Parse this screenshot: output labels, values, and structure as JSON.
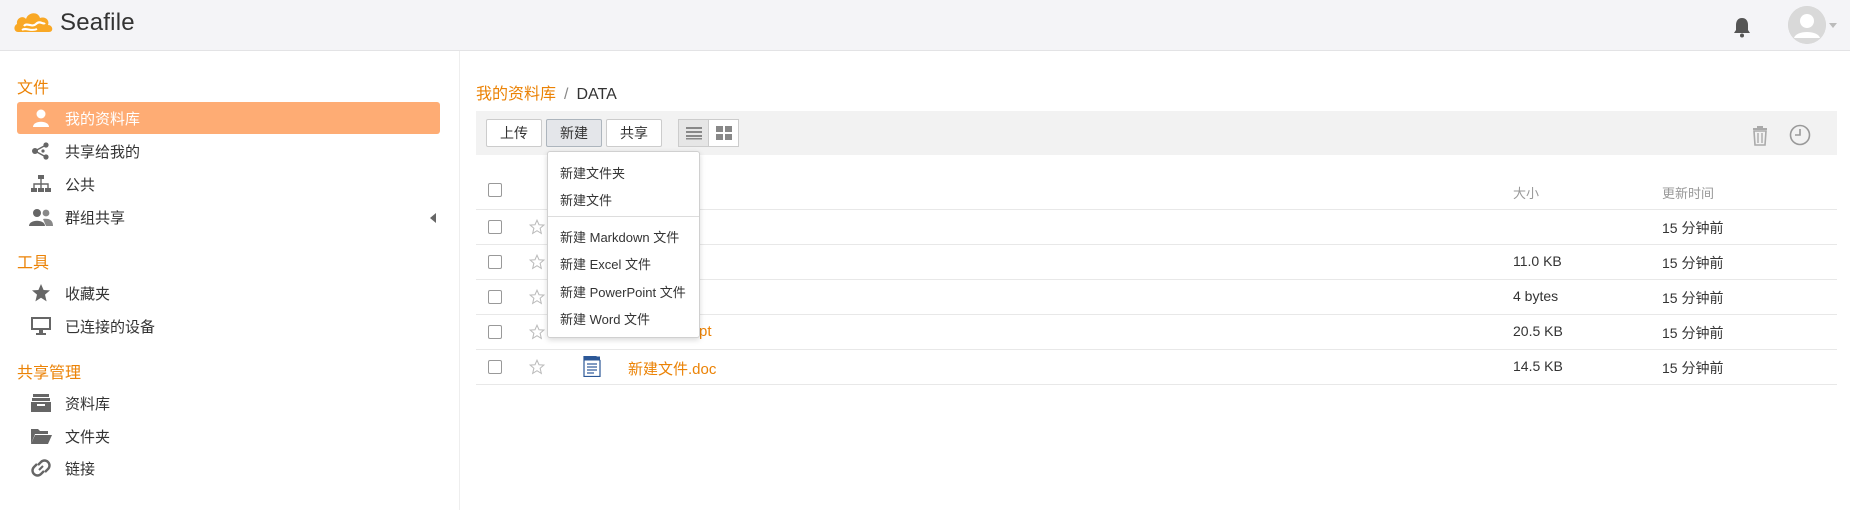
{
  "header": {
    "logo_text": "Seafile",
    "brand_color": "#f9a825"
  },
  "sidebar": {
    "sections": [
      {
        "title": "文件",
        "items": [
          {
            "label": "我的资料库",
            "icon": "user-icon",
            "active": true
          },
          {
            "label": "共享给我的",
            "icon": "share-icon"
          },
          {
            "label": "公共",
            "icon": "org-tree-icon"
          },
          {
            "label": "群组共享",
            "icon": "group-icon",
            "has_caret": true
          }
        ]
      },
      {
        "title": "工具",
        "items": [
          {
            "label": "收藏夹",
            "icon": "star-icon"
          },
          {
            "label": "已连接的设备",
            "icon": "monitor-icon"
          }
        ]
      },
      {
        "title": "共享管理",
        "items": [
          {
            "label": "资料库",
            "icon": "archive-icon"
          },
          {
            "label": "文件夹",
            "icon": "folder-open-icon"
          },
          {
            "label": "链接",
            "icon": "link-icon"
          }
        ]
      }
    ]
  },
  "breadcrumb": {
    "root": "我的资料库",
    "separator": "/",
    "current": "DATA"
  },
  "toolbar": {
    "upload": "上传",
    "new": "新建",
    "share": "共享"
  },
  "dropdown": {
    "items": [
      "新建文件夹",
      "新建文件",
      "新建 Markdown 文件",
      "新建 Excel 文件",
      "新建 PowerPoint 文件",
      "新建 Word 文件"
    ]
  },
  "table": {
    "headers": {
      "size": "大小",
      "modified": "更新时间"
    },
    "rows": [
      {
        "name": "",
        "size": "",
        "modified": "15 分钟前",
        "type": "folder"
      },
      {
        "name": "s",
        "size": "11.0 KB",
        "modified": "15 分钟前",
        "type": "excel"
      },
      {
        "name": "t",
        "size": "4 bytes",
        "modified": "15 分钟前",
        "type": "text"
      },
      {
        "name": "pt",
        "size": "20.5 KB",
        "modified": "15 分钟前",
        "type": "ppt"
      },
      {
        "name": "新建文件.doc",
        "size": "14.5 KB",
        "modified": "15 分钟前",
        "type": "doc"
      }
    ]
  },
  "colors": {
    "accent": "#eb8205",
    "active_nav": "#feac74"
  }
}
